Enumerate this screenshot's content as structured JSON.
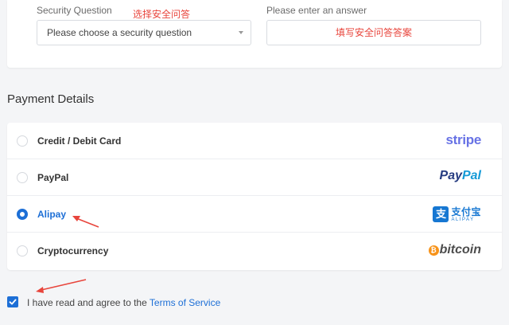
{
  "security": {
    "question_label": "Security Question",
    "question_annotation": "选择安全问答",
    "question_placeholder": "Please choose a security question",
    "answer_label": "Please enter an answer",
    "answer_annotation": "填写安全问答答案"
  },
  "payment": {
    "title": "Payment Details",
    "methods": [
      {
        "label": "Credit / Debit Card",
        "logo": "stripe",
        "selected": false
      },
      {
        "label": "PayPal",
        "logo": "PayPal",
        "selected": false
      },
      {
        "label": "Alipay",
        "logo": "支付宝 ALIPAY",
        "selected": true
      },
      {
        "label": "Cryptocurrency",
        "logo": "bitcoin",
        "selected": false
      }
    ]
  },
  "agreement": {
    "text": "I have read and agree to the",
    "link": "Terms of Service",
    "checked": true
  },
  "logos": {
    "stripe": "stripe",
    "paypal_a": "Pay",
    "paypal_b": "Pal",
    "alipay_mark": "支",
    "alipay_cn": "支付宝",
    "alipay_en": "ALIPAY",
    "bitcoin_symbol": "₿",
    "bitcoin_text": "bitcoin"
  },
  "colors": {
    "accent": "#1d6fd6",
    "annotation": "#e8453c"
  }
}
